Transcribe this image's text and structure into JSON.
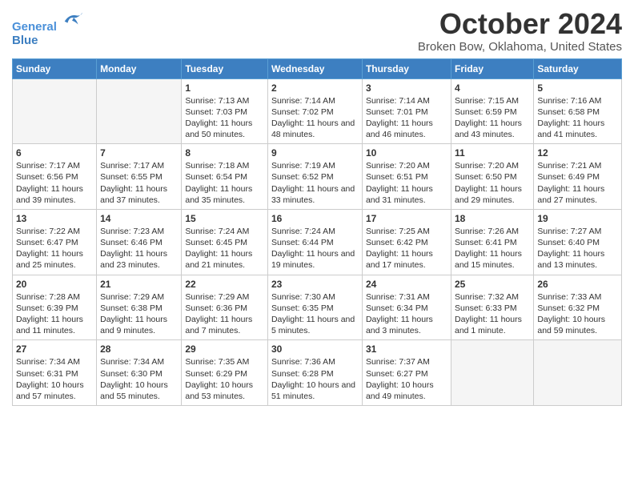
{
  "logo": {
    "line1": "General",
    "line2": "Blue"
  },
  "title": "October 2024",
  "subtitle": "Broken Bow, Oklahoma, United States",
  "days_header": [
    "Sunday",
    "Monday",
    "Tuesday",
    "Wednesday",
    "Thursday",
    "Friday",
    "Saturday"
  ],
  "weeks": [
    [
      {
        "num": "",
        "sunrise": "",
        "sunset": "",
        "daylight": "",
        "empty": true
      },
      {
        "num": "",
        "sunrise": "",
        "sunset": "",
        "daylight": "",
        "empty": true
      },
      {
        "num": "1",
        "sunrise": "Sunrise: 7:13 AM",
        "sunset": "Sunset: 7:03 PM",
        "daylight": "Daylight: 11 hours and 50 minutes."
      },
      {
        "num": "2",
        "sunrise": "Sunrise: 7:14 AM",
        "sunset": "Sunset: 7:02 PM",
        "daylight": "Daylight: 11 hours and 48 minutes."
      },
      {
        "num": "3",
        "sunrise": "Sunrise: 7:14 AM",
        "sunset": "Sunset: 7:01 PM",
        "daylight": "Daylight: 11 hours and 46 minutes."
      },
      {
        "num": "4",
        "sunrise": "Sunrise: 7:15 AM",
        "sunset": "Sunset: 6:59 PM",
        "daylight": "Daylight: 11 hours and 43 minutes."
      },
      {
        "num": "5",
        "sunrise": "Sunrise: 7:16 AM",
        "sunset": "Sunset: 6:58 PM",
        "daylight": "Daylight: 11 hours and 41 minutes."
      }
    ],
    [
      {
        "num": "6",
        "sunrise": "Sunrise: 7:17 AM",
        "sunset": "Sunset: 6:56 PM",
        "daylight": "Daylight: 11 hours and 39 minutes."
      },
      {
        "num": "7",
        "sunrise": "Sunrise: 7:17 AM",
        "sunset": "Sunset: 6:55 PM",
        "daylight": "Daylight: 11 hours and 37 minutes."
      },
      {
        "num": "8",
        "sunrise": "Sunrise: 7:18 AM",
        "sunset": "Sunset: 6:54 PM",
        "daylight": "Daylight: 11 hours and 35 minutes."
      },
      {
        "num": "9",
        "sunrise": "Sunrise: 7:19 AM",
        "sunset": "Sunset: 6:52 PM",
        "daylight": "Daylight: 11 hours and 33 minutes."
      },
      {
        "num": "10",
        "sunrise": "Sunrise: 7:20 AM",
        "sunset": "Sunset: 6:51 PM",
        "daylight": "Daylight: 11 hours and 31 minutes."
      },
      {
        "num": "11",
        "sunrise": "Sunrise: 7:20 AM",
        "sunset": "Sunset: 6:50 PM",
        "daylight": "Daylight: 11 hours and 29 minutes."
      },
      {
        "num": "12",
        "sunrise": "Sunrise: 7:21 AM",
        "sunset": "Sunset: 6:49 PM",
        "daylight": "Daylight: 11 hours and 27 minutes."
      }
    ],
    [
      {
        "num": "13",
        "sunrise": "Sunrise: 7:22 AM",
        "sunset": "Sunset: 6:47 PM",
        "daylight": "Daylight: 11 hours and 25 minutes."
      },
      {
        "num": "14",
        "sunrise": "Sunrise: 7:23 AM",
        "sunset": "Sunset: 6:46 PM",
        "daylight": "Daylight: 11 hours and 23 minutes."
      },
      {
        "num": "15",
        "sunrise": "Sunrise: 7:24 AM",
        "sunset": "Sunset: 6:45 PM",
        "daylight": "Daylight: 11 hours and 21 minutes."
      },
      {
        "num": "16",
        "sunrise": "Sunrise: 7:24 AM",
        "sunset": "Sunset: 6:44 PM",
        "daylight": "Daylight: 11 hours and 19 minutes."
      },
      {
        "num": "17",
        "sunrise": "Sunrise: 7:25 AM",
        "sunset": "Sunset: 6:42 PM",
        "daylight": "Daylight: 11 hours and 17 minutes."
      },
      {
        "num": "18",
        "sunrise": "Sunrise: 7:26 AM",
        "sunset": "Sunset: 6:41 PM",
        "daylight": "Daylight: 11 hours and 15 minutes."
      },
      {
        "num": "19",
        "sunrise": "Sunrise: 7:27 AM",
        "sunset": "Sunset: 6:40 PM",
        "daylight": "Daylight: 11 hours and 13 minutes."
      }
    ],
    [
      {
        "num": "20",
        "sunrise": "Sunrise: 7:28 AM",
        "sunset": "Sunset: 6:39 PM",
        "daylight": "Daylight: 11 hours and 11 minutes."
      },
      {
        "num": "21",
        "sunrise": "Sunrise: 7:29 AM",
        "sunset": "Sunset: 6:38 PM",
        "daylight": "Daylight: 11 hours and 9 minutes."
      },
      {
        "num": "22",
        "sunrise": "Sunrise: 7:29 AM",
        "sunset": "Sunset: 6:36 PM",
        "daylight": "Daylight: 11 hours and 7 minutes."
      },
      {
        "num": "23",
        "sunrise": "Sunrise: 7:30 AM",
        "sunset": "Sunset: 6:35 PM",
        "daylight": "Daylight: 11 hours and 5 minutes."
      },
      {
        "num": "24",
        "sunrise": "Sunrise: 7:31 AM",
        "sunset": "Sunset: 6:34 PM",
        "daylight": "Daylight: 11 hours and 3 minutes."
      },
      {
        "num": "25",
        "sunrise": "Sunrise: 7:32 AM",
        "sunset": "Sunset: 6:33 PM",
        "daylight": "Daylight: 11 hours and 1 minute."
      },
      {
        "num": "26",
        "sunrise": "Sunrise: 7:33 AM",
        "sunset": "Sunset: 6:32 PM",
        "daylight": "Daylight: 10 hours and 59 minutes."
      }
    ],
    [
      {
        "num": "27",
        "sunrise": "Sunrise: 7:34 AM",
        "sunset": "Sunset: 6:31 PM",
        "daylight": "Daylight: 10 hours and 57 minutes."
      },
      {
        "num": "28",
        "sunrise": "Sunrise: 7:34 AM",
        "sunset": "Sunset: 6:30 PM",
        "daylight": "Daylight: 10 hours and 55 minutes."
      },
      {
        "num": "29",
        "sunrise": "Sunrise: 7:35 AM",
        "sunset": "Sunset: 6:29 PM",
        "daylight": "Daylight: 10 hours and 53 minutes."
      },
      {
        "num": "30",
        "sunrise": "Sunrise: 7:36 AM",
        "sunset": "Sunset: 6:28 PM",
        "daylight": "Daylight: 10 hours and 51 minutes."
      },
      {
        "num": "31",
        "sunrise": "Sunrise: 7:37 AM",
        "sunset": "Sunset: 6:27 PM",
        "daylight": "Daylight: 10 hours and 49 minutes."
      },
      {
        "num": "",
        "sunrise": "",
        "sunset": "",
        "daylight": "",
        "empty": true
      },
      {
        "num": "",
        "sunrise": "",
        "sunset": "",
        "daylight": "",
        "empty": true
      }
    ]
  ]
}
